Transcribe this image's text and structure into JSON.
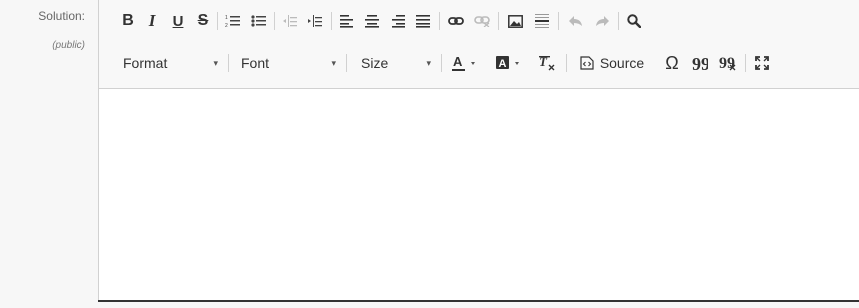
{
  "field": {
    "label": "Solution:",
    "sublabel": "(public)"
  },
  "toolbar": {
    "format_label": "Format",
    "font_label": "Font",
    "size_label": "Size",
    "source_label": "Source",
    "bold_glyph": "B",
    "italic_glyph": "I",
    "underline_glyph": "U",
    "strike_glyph": "S",
    "omega_glyph": "Ω",
    "dropdown_glyph": "▾"
  },
  "editor": {
    "content": ""
  }
}
